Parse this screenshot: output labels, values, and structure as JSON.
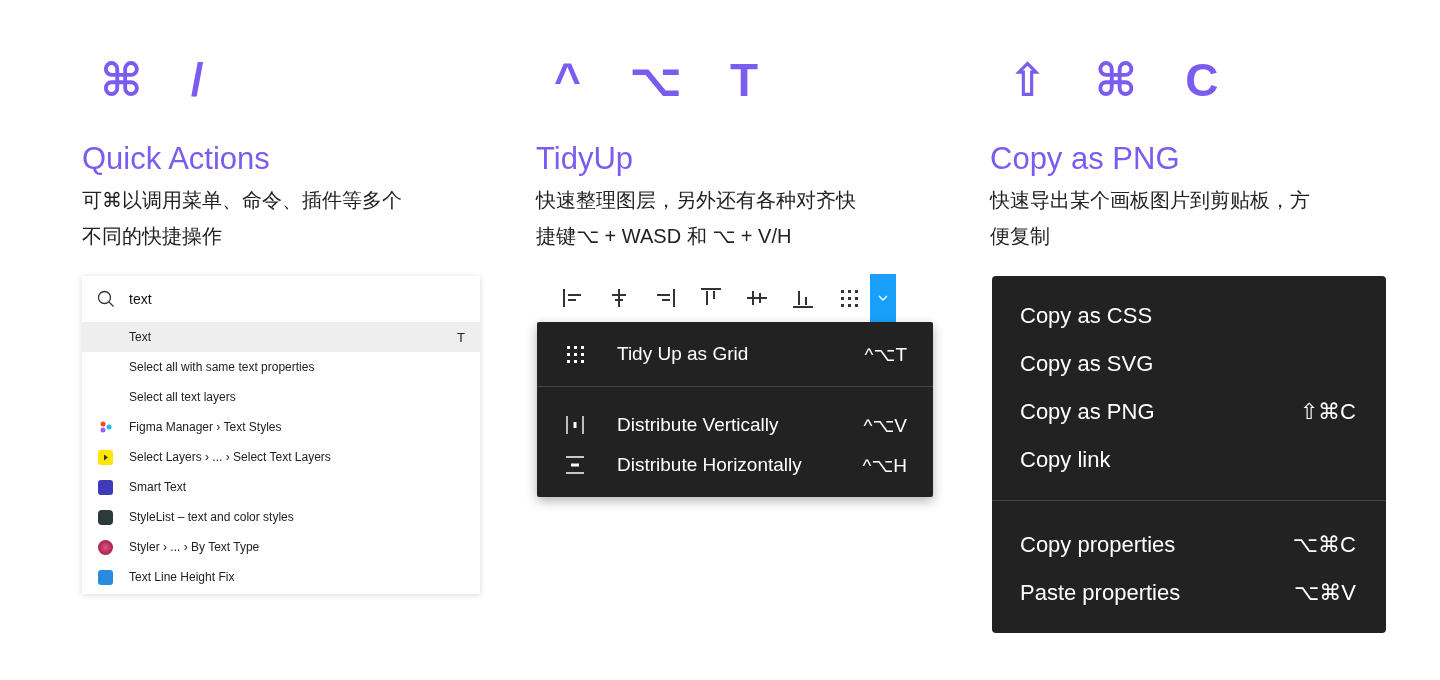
{
  "features": [
    {
      "keys": [
        "⌘",
        "/"
      ],
      "title": "Quick Actions",
      "description": "可⌘以调用菜单、命令、插件等多个不同的快捷操作",
      "kind": "quick-actions"
    },
    {
      "keys": [
        "^",
        "⌥",
        "T"
      ],
      "title": "TidyUp",
      "description": "快速整理图层，另外还有各种对齐快捷键⌥ + WASD 和 ⌥ + V/H",
      "kind": "tidy-up"
    },
    {
      "keys": [
        "⇧",
        "⌘",
        "C"
      ],
      "title": "Copy as PNG",
      "description": "快速导出某个画板图片到剪贴板，方便复制",
      "kind": "copy-menu"
    }
  ],
  "quick_actions": {
    "search": {
      "value": "text"
    },
    "results": [
      {
        "label": "Text",
        "shortcut": "T",
        "selected": true
      },
      {
        "label": "Select all with same text properties",
        "selected": false
      },
      {
        "label": "Select all text layers",
        "selected": false
      },
      {
        "label": "Figma Manager › Text Styles",
        "selected": false
      },
      {
        "label": "Select Layers › ... › Select Text Layers",
        "selected": false
      },
      {
        "label": "Smart Text",
        "selected": false
      },
      {
        "label": "StyleList – text and color styles",
        "selected": false
      },
      {
        "label": "Styler › ... › By Text Type",
        "selected": false
      },
      {
        "label": "Text Line Height Fix",
        "selected": false
      }
    ]
  },
  "tidy_up": {
    "dropdown": {
      "expanded": true
    },
    "menu": [
      [
        {
          "label": "Tidy Up as Grid",
          "shortcut": "^⌥T"
        }
      ],
      [
        {
          "label": "Distribute Vertically",
          "shortcut": "^⌥V"
        },
        {
          "label": "Distribute Horizontally",
          "shortcut": "^⌥H"
        }
      ]
    ]
  },
  "copy_menu": [
    [
      {
        "label": "Copy as CSS"
      },
      {
        "label": "Copy as SVG"
      },
      {
        "label": "Copy as PNG",
        "shortcut": "⇧⌘C"
      },
      {
        "label": "Copy link"
      }
    ],
    [
      {
        "label": "Copy properties",
        "shortcut": "⌥⌘C"
      },
      {
        "label": "Paste properties",
        "shortcut": "⌥⌘V"
      }
    ]
  ]
}
